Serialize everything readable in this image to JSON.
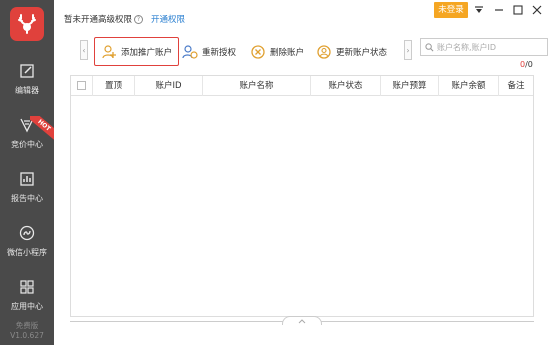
{
  "sidebar": {
    "logo_icon": "antler-logo-icon",
    "items": [
      {
        "label": "编辑器",
        "icon": "edit-icon"
      },
      {
        "label": "竞价中心",
        "icon": "bid-icon",
        "badge": "HOT"
      },
      {
        "label": "报告中心",
        "icon": "report-icon"
      },
      {
        "label": "微信小程序",
        "icon": "mini-program-icon"
      },
      {
        "label": "应用中心",
        "icon": "apps-icon"
      }
    ],
    "edition": "免费版",
    "version": "V1.0.627"
  },
  "topbar": {
    "message": "暂未开通高级权限",
    "link": "开通权限",
    "login": "未登录"
  },
  "toolbar": {
    "buttons": [
      {
        "label": "添加推广账户",
        "icon": "add-user-icon"
      },
      {
        "label": "重新授权",
        "icon": "reauthorize-icon"
      },
      {
        "label": "删除账户",
        "icon": "delete-icon"
      },
      {
        "label": "更新账户状态",
        "icon": "refresh-user-icon"
      }
    ],
    "search_placeholder": "账户名称,账户ID"
  },
  "count": {
    "selected": "0",
    "total": "0"
  },
  "table": {
    "columns": [
      "置顶",
      "账户ID",
      "账户名称",
      "账户状态",
      "账户预算",
      "账户余额",
      "备注"
    ]
  },
  "colors": {
    "accent": "#e0413c",
    "sidebar_bg": "#4a4a4a",
    "login_bg": "#f5a623",
    "link": "#2a7fd0"
  }
}
